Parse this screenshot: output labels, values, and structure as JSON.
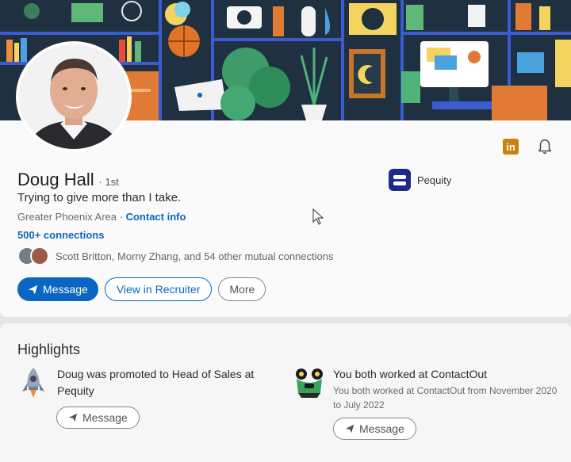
{
  "profile": {
    "name": "Doug Hall",
    "degree": "· 1st",
    "headline": "Trying to give more than I take.",
    "location": "Greater Phoenix Area ·",
    "contact_info": "Contact info",
    "connections": "500+ connections",
    "mutual": "Scott Britton, Morny Zhang, and 54 other mutual connections",
    "company": "Pequity"
  },
  "actions": {
    "message": "Message",
    "view_recruiter": "View in Recruiter",
    "more": "More"
  },
  "top_icons": {
    "linkedin_badge": "in",
    "bell": "bell-icon"
  },
  "highlights": {
    "title": "Highlights",
    "items": [
      {
        "main": "Doug was promoted to Head of Sales at Pequity",
        "sub": "",
        "button": "Message",
        "icon": "rocket-icon"
      },
      {
        "main": "You both worked at ContactOut",
        "sub": "You both worked at ContactOut from November 2020 to July 2022",
        "button": "Message",
        "icon": "contactout-logo-icon"
      }
    ]
  },
  "colors": {
    "accent": "#0a66c2",
    "company_logo": "#1c2a8a",
    "linkedin_badge": "#c9820f"
  }
}
